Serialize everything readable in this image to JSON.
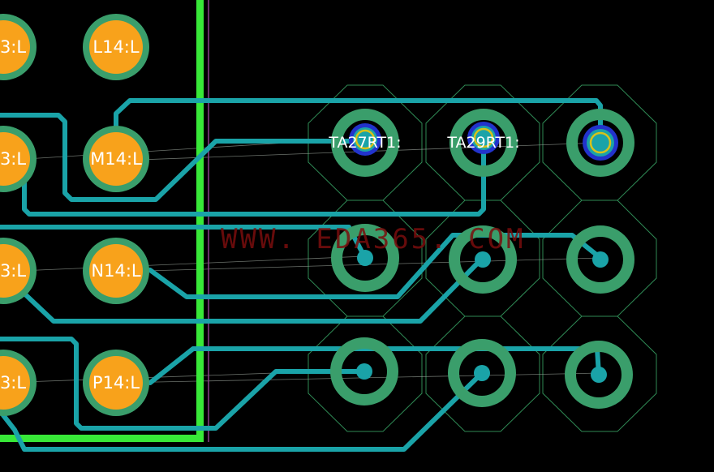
{
  "colors": {
    "background": "#000000",
    "pad_ring": "#3a9e6b",
    "pad_core": "#f8a21b",
    "trace": "#1aa3a8",
    "keepout_line": "#38e838",
    "outline": "#2f8a55",
    "ratsnest": "#9aa39a",
    "drill_blue": "#2233cc",
    "drill_yellow": "#d7c21a",
    "watermark": "#7a0e0e"
  },
  "left_pads": [
    {
      "label": "3:L"
    },
    {
      "label": "L14:L"
    },
    {
      "label": "3:L"
    },
    {
      "label": "M14:L"
    },
    {
      "label": "3:L"
    },
    {
      "label": "N14:L"
    },
    {
      "label": "3:L"
    },
    {
      "label": "P14:L"
    }
  ],
  "ref_labels": {
    "ta27": "TA27RT1:",
    "ta29": "TA29RT1:"
  },
  "watermark": "WWW. EDA365. COM"
}
